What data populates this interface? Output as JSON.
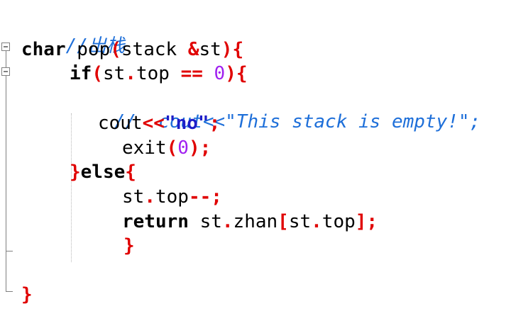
{
  "code": {
    "l1_comment": "//出栈",
    "l2_type": "char",
    "l2_name": " pop",
    "l2_paren_open": "(",
    "l2_param_type": "stack ",
    "l2_amp": "&",
    "l2_param": "st",
    "l2_paren_close": ")",
    "l2_brace": "{",
    "l3_kw": "if",
    "l3_paren_open": "(",
    "l3_obj": "st",
    "l3_dot": ".",
    "l3_member": "top ",
    "l3_eq": "==",
    "l3_zero": "0",
    "l3_paren_close": ")",
    "l3_brace": "{",
    "l4_comment": "//  cout<<\"This stack is empty!\";",
    "l5_cout": "cout",
    "l5_shift": "<<",
    "l5_str": "\"no\"",
    "l5_semi": ";",
    "l6_exit": "exit",
    "l6_paren_open": "(",
    "l6_zero": "0",
    "l6_paren_close": ")",
    "l6_semi": ";",
    "l7_brace_close": "}",
    "l7_else": "else",
    "l7_brace_open": "{",
    "l8_obj": "st",
    "l8_dot": ".",
    "l8_member": "top",
    "l8_dec": "--",
    "l8_semi": ";",
    "l9_return": "return",
    "l9_obj": " st",
    "l9_dot": ".",
    "l9_member": "zhan",
    "l9_bracket_open": "[",
    "l9_obj2": "st",
    "l9_dot2": ".",
    "l9_member2": "top",
    "l9_bracket_close": "]",
    "l9_semi": ";",
    "l10_brace": "}",
    "l12_brace": "}"
  }
}
